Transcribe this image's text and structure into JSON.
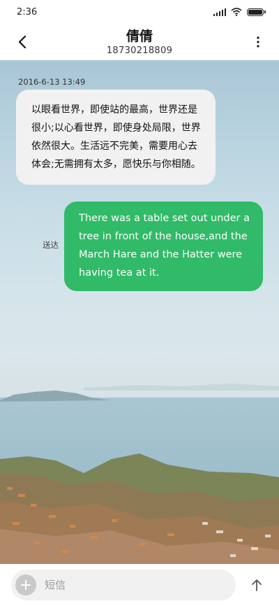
{
  "status_bar": {
    "time": "2:36",
    "icons": [
      "signal-icon",
      "wifi-icon",
      "battery-icon"
    ],
    "battery_level": 1.0
  },
  "header": {
    "contact_name": "倩倩",
    "phone_number": "18730218809",
    "back_icon": "chevron-left-icon",
    "more_icon": "vertical-dots-icon"
  },
  "conversation": {
    "timestamp": "2016-6-13 13:49",
    "incoming": {
      "text": "以眼看世界，即使站的最高，世界还是很小;以心看世界，即使身处局限，世界依然很大。生活远不完美，需要用心去体会;无需拥有太多，愿快乐与你相随。"
    },
    "outgoing": {
      "text": "There was a table set out under a tree in front of the house,and the March Hare and the Hatter were having tea at it.",
      "status": "送达"
    }
  },
  "composer": {
    "placeholder": "短信",
    "value": "",
    "add_icon": "plus-icon",
    "send_icon": "arrow-up-icon"
  },
  "colors": {
    "outgoing_bubble": "#31ba68",
    "incoming_bubble": "#f1f1f1",
    "header_bg": "#ffffff"
  }
}
